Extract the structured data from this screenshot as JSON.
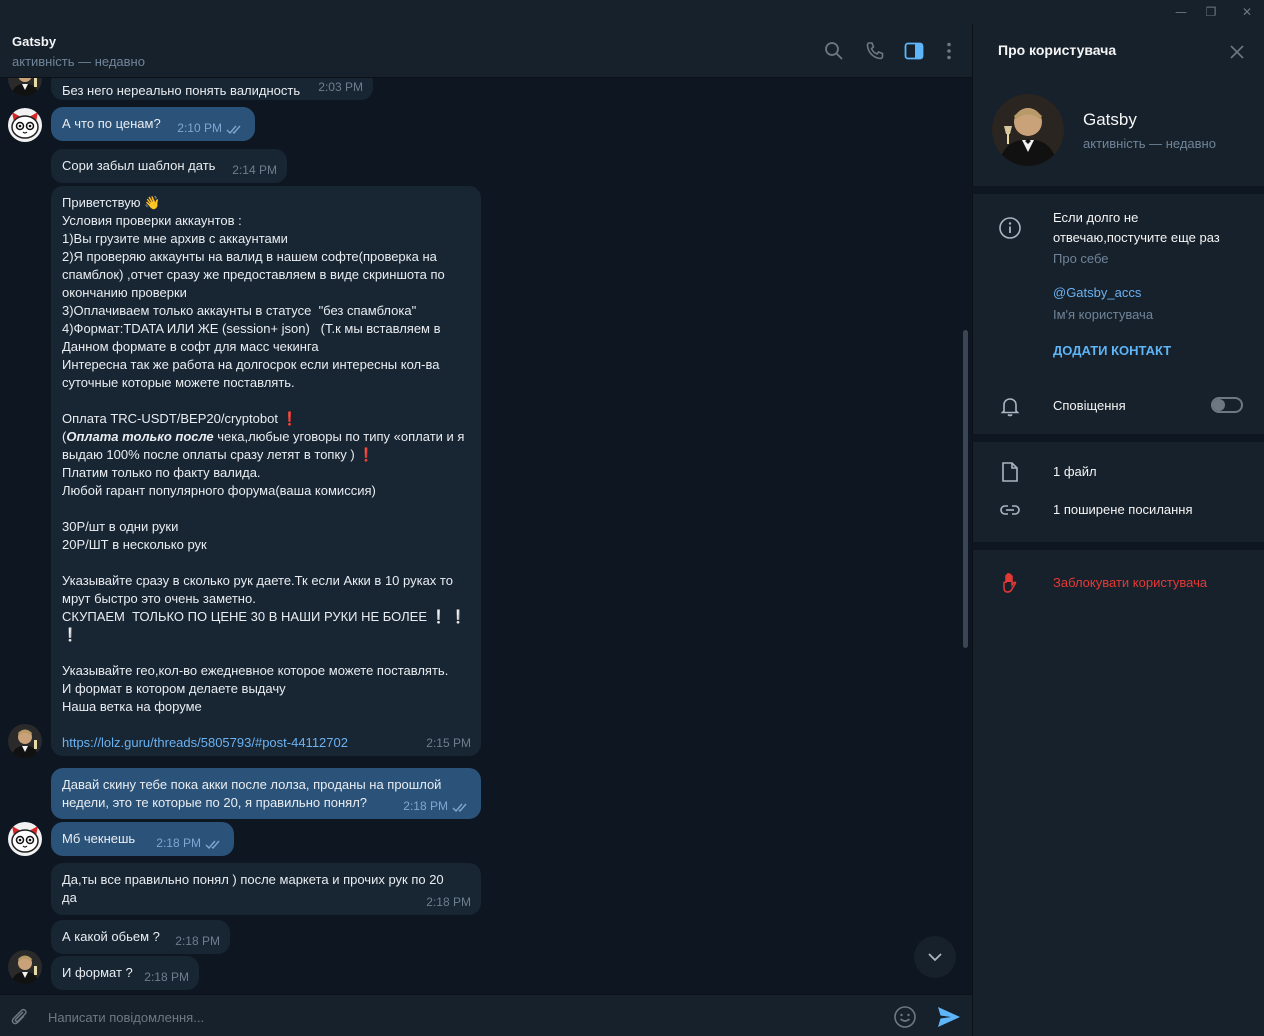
{
  "titlebar": {
    "minimize": "—",
    "maximize": "❐",
    "close": "✕"
  },
  "chat": {
    "title": "Gatsby",
    "status": "активність — недавно"
  },
  "messages": [
    {
      "id": "m1",
      "dir": "in",
      "text": "Без него нереально понять валидность",
      "time": "2:03 PM"
    },
    {
      "id": "m2",
      "dir": "out",
      "text": "А что по ценам?",
      "time": "2:10 PM"
    },
    {
      "id": "m3",
      "dir": "in",
      "text": "Сори забыл шаблон дать",
      "time": "2:14 PM"
    },
    {
      "id": "m5",
      "dir": "out",
      "text": "Давай скину тебе пока акки после лолза, проданы на прошлой\nнедели, это те которые по 20, я правильно понял?",
      "time": "2:18 PM"
    },
    {
      "id": "m6",
      "dir": "out",
      "text": "Мб чекнешь",
      "time": "2:18 PM"
    },
    {
      "id": "m7",
      "dir": "in",
      "text": "Да,ты все правильно понял ) после маркета и прочих рук по 20\nда",
      "time": "2:18 PM"
    },
    {
      "id": "m8",
      "dir": "in",
      "text": "А какой обьем ?",
      "time": "2:18 PM"
    },
    {
      "id": "m9",
      "dir": "in",
      "text": "И формат ?",
      "time": "2:18 PM"
    }
  ],
  "template_msg": {
    "greeting": "Приветствую 👋",
    "conditions": "Условия проверки аккаунтов :\n1)Вы грузите мне архив с аккаунтами\n2)Я проверяю аккаунты на валид в нашем софте(проверка на\nспамблок) ,отчет сразу же предоставляем в виде скриншота по\nокончанию проверки\n3)Оплачиваем только аккаунты в статусе  \"без спамблока\"\n4)Формат:TDATA ИЛИ ЖЕ (session+ json)   (Т.к мы вставляем в\nДанном формате в софт для масс чекинга\nИнтересна так же работа на долгосрок если интересны кол-ва\nсуточные которые можете поставлять.",
    "payment": "Оплата TRC-USDT/BEP20/cryptobot",
    "payment_mark": "❗",
    "open_paren": "(",
    "bold_part": "Оплата только после",
    "payment_rest": " чека,любые уговоры по типу «оплати и я\nвыдаю 100% после оплаты сразу летят в топку )",
    "payment_rest_mark": " ❗",
    "payment_tail": "Платим только по факту валида.\nЛюбой гарант популярного форума(ваша комиссия)",
    "prices": "30Р/шт в одни руки\n20Р/ШТ в несколько рук",
    "hands": "Указывайте сразу в сколько рук даете.Тк если Акки в 10 руках то\nмрут быстро это очень заметно.\nСКУПАЕМ  ТОЛЬКО ПО ЦЕНЕ 30 В НАШИ РУКИ НЕ БОЛЕЕ",
    "hands_marks": " ❕ ❕\n❕",
    "geo": "Указывайте гео,кол-во ежедневное которое можете поставлять.\nИ формат в котором делаете выдачу\nНаша ветка на форуме",
    "link": "https://lolz.guru/threads/5805793/#post-44112702",
    "time": "2:15 PM"
  },
  "composer": {
    "placeholder": "Написати повідомлення..."
  },
  "panel": {
    "title": "Про користувача",
    "name": "Gatsby",
    "status": "активність — недавно",
    "bio": "Если долго не\nотвечаю,постучите еще раз",
    "bio_label": "Про себе",
    "username": "@Gatsby_accs",
    "username_label": "Ім'я користувача",
    "add_contact": "ДОДАТИ КОНТАКТ",
    "notifications": "Сповіщення",
    "notifications_on": false,
    "files": "1 файл",
    "links": "1 поширене посилання",
    "block": "Заблокувати користувача"
  },
  "colors": {
    "accent": "#5eb5f7",
    "danger": "#e53935",
    "bubble_in": "#182533",
    "bubble_out": "#2b5278"
  }
}
